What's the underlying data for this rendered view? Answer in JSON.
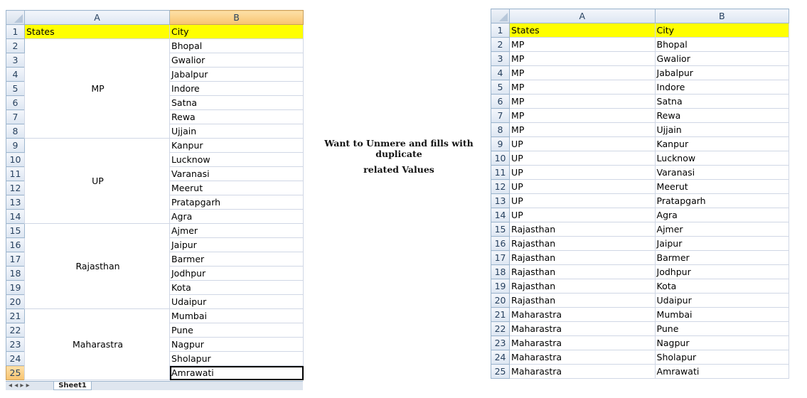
{
  "column_headers": {
    "a": "A",
    "b": "B"
  },
  "header_row": {
    "states": "States",
    "city": "City"
  },
  "left_groups": [
    {
      "state": "MP",
      "cities": [
        "Bhopal",
        "Gwalior",
        "Jabalpur",
        "Indore",
        "Satna",
        "Rewa",
        "Ujjain"
      ]
    },
    {
      "state": "UP",
      "cities": [
        "Kanpur",
        "Lucknow",
        "Varanasi",
        "Meerut",
        "Pratapgarh",
        "Agra"
      ]
    },
    {
      "state": "Rajasthan",
      "cities": [
        "Ajmer",
        "Jaipur",
        "Barmer",
        "Jodhpur",
        "Kota",
        "Udaipur"
      ]
    },
    {
      "state": "Maharastra",
      "cities": [
        "Mumbai",
        "Pune",
        "Nagpur",
        "Sholapur",
        "Amrawati"
      ]
    }
  ],
  "right_rows": [
    [
      "MP",
      "Bhopal"
    ],
    [
      "MP",
      "Gwalior"
    ],
    [
      "MP",
      "Jabalpur"
    ],
    [
      "MP",
      "Indore"
    ],
    [
      "MP",
      "Satna"
    ],
    [
      "MP",
      "Rewa"
    ],
    [
      "MP",
      "Ujjain"
    ],
    [
      "UP",
      "Kanpur"
    ],
    [
      "UP",
      "Lucknow"
    ],
    [
      "UP",
      "Varanasi"
    ],
    [
      "UP",
      "Meerut"
    ],
    [
      "UP",
      "Pratapgarh"
    ],
    [
      "UP",
      "Agra"
    ],
    [
      "Rajasthan",
      "Ajmer"
    ],
    [
      "Rajasthan",
      "Jaipur"
    ],
    [
      "Rajasthan",
      "Barmer"
    ],
    [
      "Rajasthan",
      "Jodhpur"
    ],
    [
      "Rajasthan",
      "Kota"
    ],
    [
      "Rajasthan",
      "Udaipur"
    ],
    [
      "Maharastra",
      "Mumbai"
    ],
    [
      "Maharastra",
      "Pune"
    ],
    [
      "Maharastra",
      "Nagpur"
    ],
    [
      "Maharastra",
      "Sholapur"
    ],
    [
      "Maharastra",
      "Amrawati"
    ]
  ],
  "note": {
    "line1": "Want to Unmere and fills with duplicate",
    "line2": "related Values"
  },
  "sheet_tabs": {
    "active": "Sheet1"
  },
  "colors": {
    "header_fill": "#ffff00",
    "grid": "#d0d7e5",
    "selected_header": "#f8c470"
  }
}
